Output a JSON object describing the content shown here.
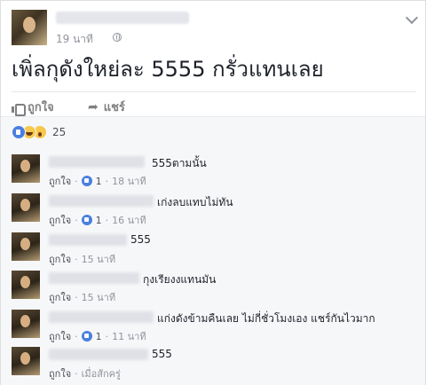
{
  "post": {
    "time": "19 นาที",
    "text": "เพิ่ลกุดังใหย่ละ 5555 กรั่วแทนเลย",
    "like_label": "ถูกใจ",
    "share_label": "แชร์"
  },
  "reactions": {
    "count": "25"
  },
  "comments": [
    {
      "text": "555ตามนั้น",
      "like_label": "ถูกใจ",
      "like_count": "1",
      "time": "18 นาที"
    },
    {
      "text": "เก่งลบแทบไม่ทัน",
      "like_label": "ถูกใจ",
      "like_count": "1",
      "time": "16 นาที"
    },
    {
      "text": "555",
      "like_label": "ถูกใจ",
      "time": "15 นาที"
    },
    {
      "text": "กุงเรียงงแทนมัน",
      "like_label": "ถูกใจ",
      "time": "15 นาที"
    },
    {
      "text": "แก่งดังข้ามคืนเลย ไม่กี่ชั่วโมงเอง แชร์กันไวมาก",
      "like_label": "ถูกใจ",
      "like_count": "1",
      "time": "11 นาที"
    },
    {
      "text": "555",
      "like_label": "ถูกใจ",
      "time": "เมื่อสักครู่"
    }
  ],
  "colors": {
    "link_blue": "#4a7fdf",
    "meta_gray": "#90949c",
    "comments_bg": "#f6f7f9"
  },
  "icons": [
    "globe-icon",
    "chevron-down-icon",
    "thumb-icon",
    "share-icon",
    "like-reaction-icon",
    "haha-reaction-icon",
    "wow-reaction-icon",
    "mini-like-icon"
  ]
}
